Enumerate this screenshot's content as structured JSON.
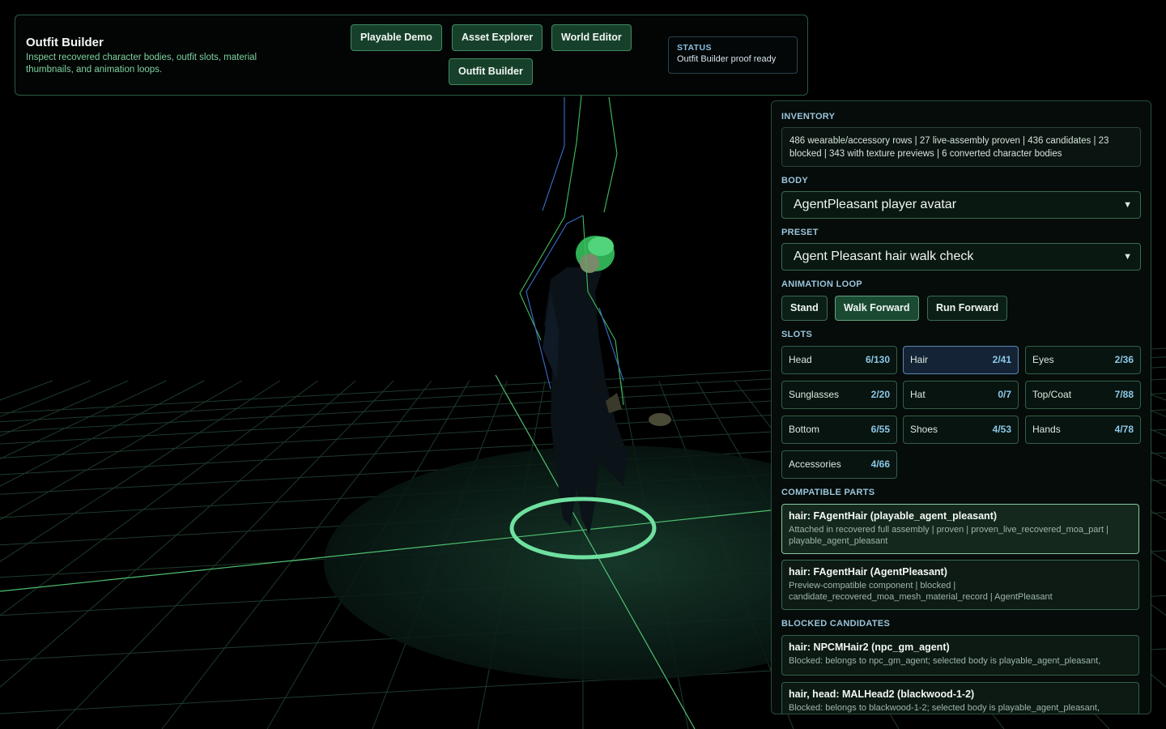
{
  "header": {
    "title": "Outfit Builder",
    "description": "Inspect recovered character bodies, outfit slots, material thumbnails, and animation loops.",
    "nav": [
      "Playable Demo",
      "Asset Explorer",
      "World Editor",
      "Outfit Builder"
    ],
    "status_label": "STATUS",
    "status_text": "Outfit Builder proof ready"
  },
  "sidebar": {
    "inventory_label": "INVENTORY",
    "inventory_text": "486 wearable/accessory rows | 27 live-assembly proven | 436 candidates | 23 blocked | 343 with texture previews | 6 converted character bodies",
    "body_label": "BODY",
    "body_value": "AgentPleasant player avatar",
    "preset_label": "PRESET",
    "preset_value": "Agent Pleasant hair walk check",
    "animation_label": "ANIMATION LOOP",
    "animations": [
      "Stand",
      "Walk Forward",
      "Run Forward"
    ],
    "active_animation": "Walk Forward",
    "slots_label": "SLOTS",
    "slots": [
      {
        "name": "Head",
        "count": "6/130"
      },
      {
        "name": "Hair",
        "count": "2/41"
      },
      {
        "name": "Eyes",
        "count": "2/36"
      },
      {
        "name": "Sunglasses",
        "count": "2/20"
      },
      {
        "name": "Hat",
        "count": "0/7"
      },
      {
        "name": "Top/Coat",
        "count": "7/88"
      },
      {
        "name": "Bottom",
        "count": "6/55"
      },
      {
        "name": "Shoes",
        "count": "4/53"
      },
      {
        "name": "Hands",
        "count": "4/78"
      },
      {
        "name": "Accessories",
        "count": "4/66"
      }
    ],
    "active_slot": "Hair",
    "compatible_label": "COMPATIBLE PARTS",
    "compatible": [
      {
        "title": "hair: FAgentHair (playable_agent_pleasant)",
        "desc": "Attached in recovered full assembly | proven | proven_live_recovered_moa_part | playable_agent_pleasant"
      },
      {
        "title": "hair: FAgentHair (AgentPleasant)",
        "desc": "Preview-compatible component | blocked | candidate_recovered_moa_mesh_material_record | AgentPleasant"
      }
    ],
    "blocked_label": "BLOCKED CANDIDATES",
    "blocked": [
      {
        "title": "hair: NPCMHair2 (npc_gm_agent)",
        "desc": "Blocked: belongs to npc_gm_agent; selected body is playable_agent_pleasant,"
      },
      {
        "title": "hair, head: MALHead2 (blackwood-1-2)",
        "desc": "Blocked: belongs to blackwood-1-2; selected body is playable_agent_pleasant,"
      }
    ]
  },
  "colors": {
    "accent": "#17402b",
    "grid": "#3fae6a",
    "ring": "#6fe0a0",
    "hair": "#3fcf6a"
  }
}
